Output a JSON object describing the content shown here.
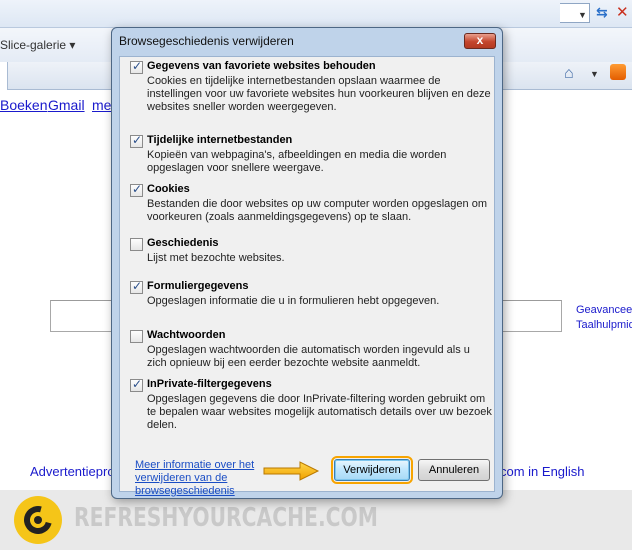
{
  "browser": {
    "slice_gallery": "Slice-galerie",
    "links": [
      "Boeken",
      "Gmail",
      "me"
    ],
    "side_links": [
      "Geavancee",
      "Taalhulpmid"
    ],
    "footer_links": [
      "Advertentiepro",
      "com in English"
    ]
  },
  "brand": {
    "text": "REFRESHYOURCACHE.COM"
  },
  "dialog": {
    "title": "Browsegeschiedenis verwijderen",
    "close_label": "x",
    "options": [
      {
        "title": "Gegevens van favoriete websites behouden",
        "checked": true,
        "description": "Cookies en tijdelijke internetbestanden opslaan waarmee de instellingen voor uw favoriete websites hun voorkeuren blijven en deze websites sneller worden weergegeven."
      },
      {
        "title": "Tijdelijke internetbestanden",
        "checked": true,
        "description": "Kopieën van webpagina's, afbeeldingen en media die worden opgeslagen voor snellere weergave."
      },
      {
        "title": "Cookies",
        "checked": true,
        "description": "Bestanden die door websites op uw computer worden opgeslagen om voorkeuren (zoals aanmeldingsgegevens) op te slaan."
      },
      {
        "title": "Geschiedenis",
        "checked": false,
        "description": "Lijst met bezochte websites."
      },
      {
        "title": "Formuliergegevens",
        "checked": true,
        "description": "Opgeslagen informatie die u in formulieren hebt opgegeven."
      },
      {
        "title": "Wachtwoorden",
        "checked": false,
        "description": "Opgeslagen wachtwoorden die automatisch worden ingevuld als u zich opnieuw bij een eerder bezochte website aanmeldt."
      },
      {
        "title": "InPrivate-filtergegevens",
        "checked": true,
        "description": "Opgeslagen gegevens die door InPrivate-filtering worden gebruikt om te bepalen waar websites mogelijk automatisch details over uw bezoek delen."
      }
    ],
    "help_link": "Meer informatie over het verwijderen van de browsegeschiedenis",
    "delete_button": "Verwijderen",
    "cancel_button": "Annuleren"
  }
}
